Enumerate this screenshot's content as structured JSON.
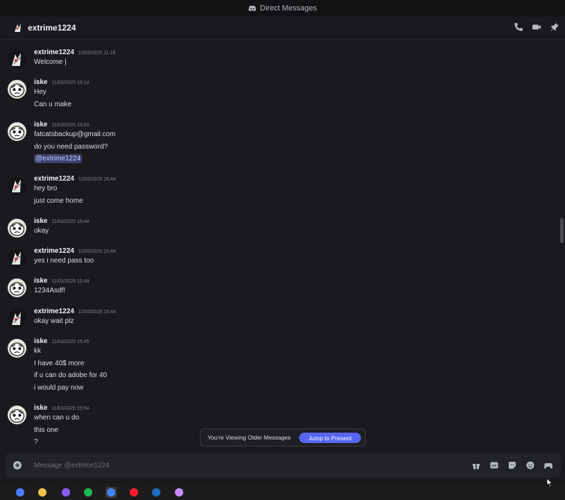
{
  "window": {
    "title": "Direct Messages"
  },
  "header": {
    "username": "extrime1224",
    "icons": [
      "phone-icon",
      "video-icon",
      "pin-icon"
    ]
  },
  "messages": [
    {
      "author": "extrime1224",
      "time": "11/03/2025 11:19",
      "lines": [
        "Welcome |"
      ],
      "avatar": "extrime"
    },
    {
      "author": "iske",
      "time": "11/03/2025 15:14",
      "lines": [
        "Hey",
        "Can u make"
      ],
      "avatar": "iske"
    },
    {
      "author": "iske",
      "time": "11/03/2025 15:24",
      "lines": [
        "fatcatsbackup@gmail.com",
        "do you need password?",
        "@extrime1224"
      ],
      "mention_index": 2,
      "avatar": "iske"
    },
    {
      "author": "extrime1224",
      "time": "11/03/2025 15:44",
      "lines": [
        "hey bro",
        "just come home"
      ],
      "avatar": "extrime"
    },
    {
      "author": "iske",
      "time": "11/03/2025 15:44",
      "lines": [
        "okay"
      ],
      "avatar": "iske"
    },
    {
      "author": "extrime1224",
      "time": "11/03/2025 15:44",
      "lines": [
        "yes i need pass too"
      ],
      "avatar": "extrime"
    },
    {
      "author": "iske",
      "time": "11/03/2025 15:44",
      "lines": [
        "1234Asdf!"
      ],
      "avatar": "iske"
    },
    {
      "author": "extrime1224",
      "time": "11/03/2025 15:44",
      "lines": [
        "okay wait plz"
      ],
      "avatar": "extrime"
    },
    {
      "author": "iske",
      "time": "11/03/2025 15:45",
      "lines": [
        "kk",
        "I have 40$ more",
        "if u can do adobe for 40",
        "i would pay now"
      ],
      "avatar": "iske"
    },
    {
      "author": "iske",
      "time": "11/03/2025 15:54",
      "lines": [
        "when can u do",
        "this one",
        "?"
      ],
      "avatar": "iske"
    }
  ],
  "older_messages": {
    "text": "You're Viewing Older Messages",
    "jump_label": "Jump to Present"
  },
  "composer": {
    "placeholder": "Message @extrime1224",
    "tools": [
      "gift-icon",
      "gif-icon",
      "sticker-icon",
      "emoji-icon",
      "activity-icon"
    ]
  },
  "taskbar": {
    "apps": [
      "app-icon-1",
      "file-explorer-icon",
      "app-icon-3",
      "spotify-icon",
      "chrome-icon",
      "opera-icon",
      "steam-icon",
      "app-icon-8"
    ]
  },
  "colors": {
    "accent": "#5865f2",
    "background": "#1a1a1e",
    "mention_bg": "#3c4270"
  }
}
